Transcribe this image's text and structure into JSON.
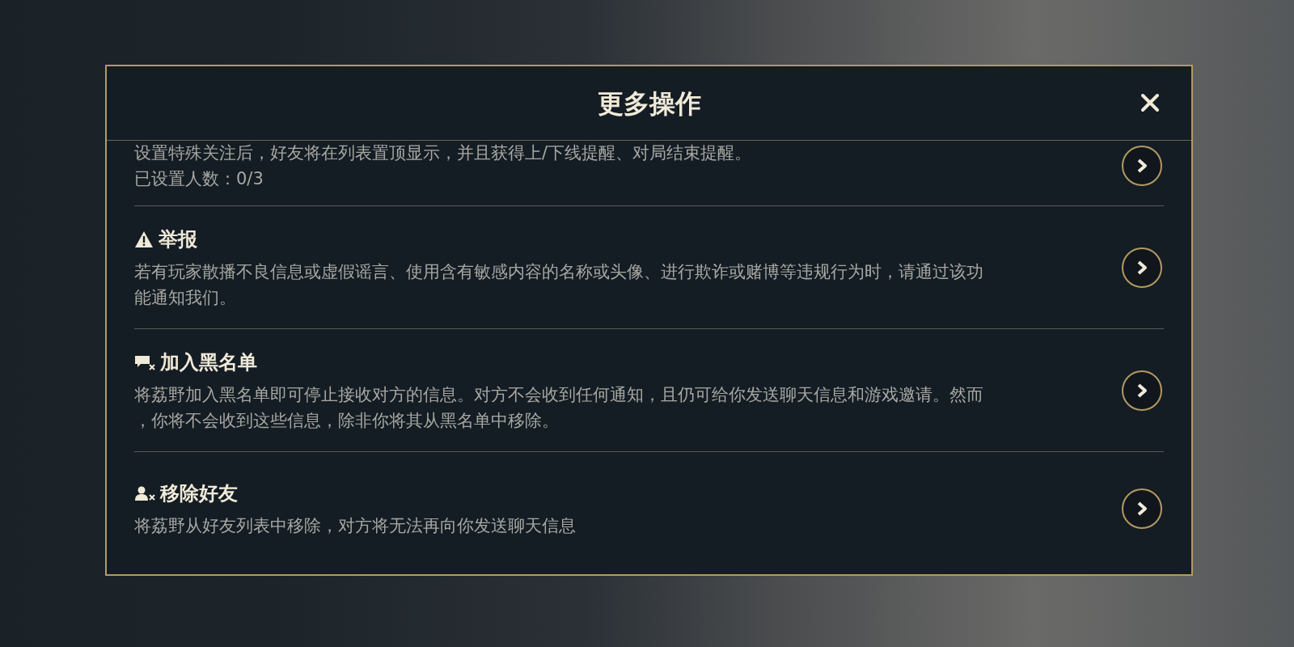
{
  "dialog": {
    "title": "更多操作",
    "items": [
      {
        "kind": "plain",
        "lines": [
          "设置特殊关注后，好友将在列表置顶显示，并且获得上/下线提醒、对局结束提醒。",
          "已设置人数：0/3"
        ]
      },
      {
        "kind": "report",
        "title": "举报",
        "lines": [
          "若有玩家散播不良信息或虚假谣言、使用含有敏感内容的名称或头像、进行欺诈或赌博等违规行为时，请通过该功",
          "能通知我们。"
        ]
      },
      {
        "kind": "block",
        "title": "加入黑名单",
        "lines": [
          "将荔野加入黑名单即可停止接收对方的信息。对方不会收到任何通知，且仍可给你发送聊天信息和游戏邀请。然而",
          "，你将不会收到这些信息，除非你将其从黑名单中移除。"
        ]
      },
      {
        "kind": "remove",
        "title": "移除好友",
        "lines": [
          "将荔野从好友列表中移除，对方将无法再向你发送聊天信息"
        ]
      }
    ]
  }
}
